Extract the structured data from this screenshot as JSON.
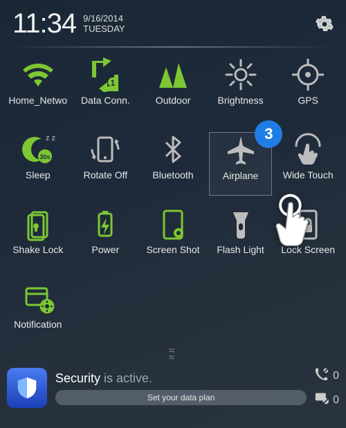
{
  "header": {
    "time": "11:34",
    "date": "9/16/2014",
    "day": "TUESDAY"
  },
  "callout_badge": "3",
  "tiles": [
    {
      "id": "wifi",
      "label": "Home_Netwo",
      "color": "green"
    },
    {
      "id": "data",
      "label": "Data Conn.",
      "color": "green"
    },
    {
      "id": "outdoor",
      "label": "Outdoor",
      "color": "green"
    },
    {
      "id": "brightness",
      "label": "Brightness",
      "color": "grey"
    },
    {
      "id": "gps",
      "label": "GPS",
      "color": "grey"
    },
    {
      "id": "sleep",
      "label": "Sleep",
      "color": "green"
    },
    {
      "id": "rotate",
      "label": "Rotate Off",
      "color": "grey"
    },
    {
      "id": "bluetooth",
      "label": "Bluetooth",
      "color": "grey"
    },
    {
      "id": "airplane",
      "label": "Airplane",
      "color": "grey",
      "selected": true
    },
    {
      "id": "widetouch",
      "label": "Wide Touch",
      "color": "grey"
    },
    {
      "id": "shakelock",
      "label": "Shake Lock",
      "color": "green"
    },
    {
      "id": "power",
      "label": "Power",
      "color": "green"
    },
    {
      "id": "screenshot",
      "label": "Screen Shot",
      "color": "green"
    },
    {
      "id": "flashlight",
      "label": "Flash Light",
      "color": "grey"
    },
    {
      "id": "lockscreen",
      "label": "Lock Screen",
      "color": "grey"
    },
    {
      "id": "notification",
      "label": "Notification",
      "color": "green"
    }
  ],
  "footer": {
    "app_name": "Security",
    "status_suffix": "is active.",
    "hint": "Set your data plan",
    "call_count": "0",
    "msg_count": "0"
  }
}
